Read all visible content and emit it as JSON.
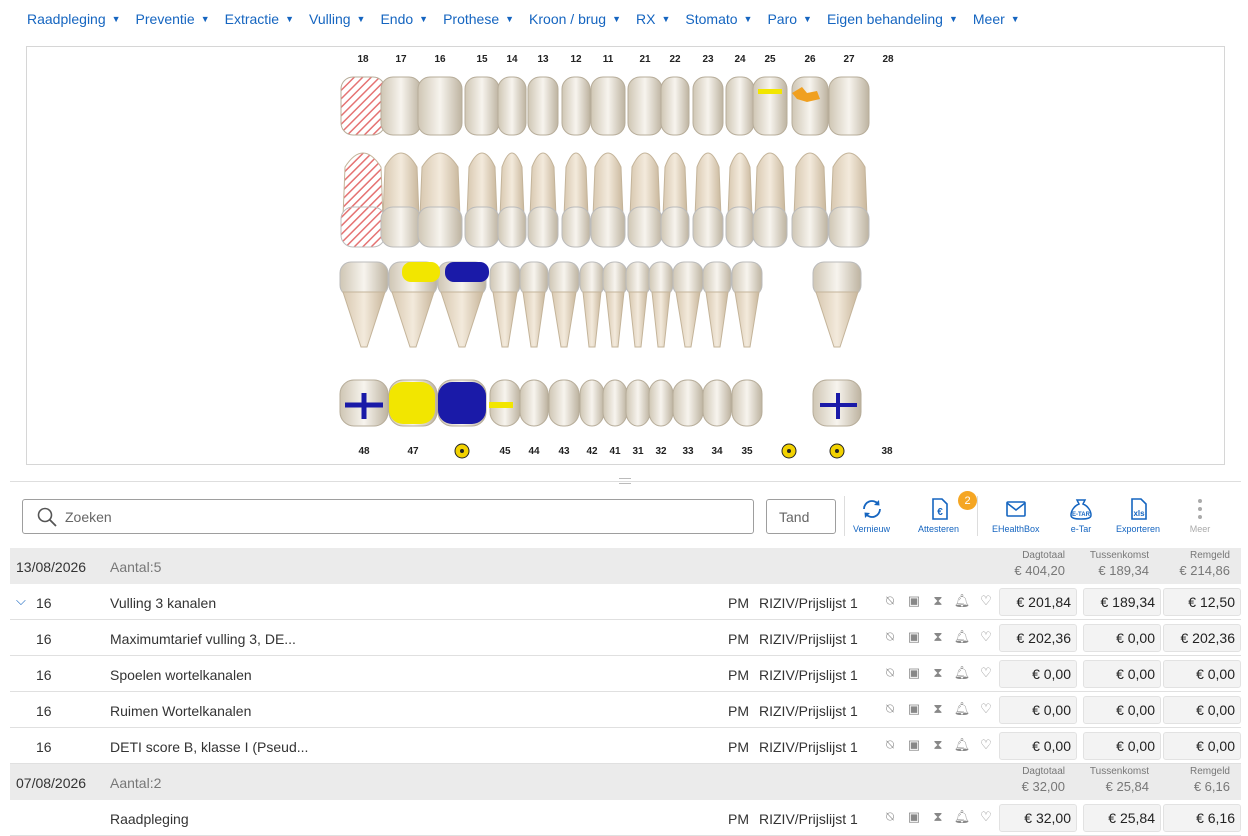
{
  "menu": [
    "Raadpleging",
    "Preventie",
    "Extractie",
    "Vulling",
    "Endo",
    "Prothese",
    "Kroon / brug",
    "RX",
    "Stomato",
    "Paro",
    "Eigen behandeling",
    "Meer"
  ],
  "odontogram": {
    "upper_numbers": [
      "18",
      "17",
      "16",
      "15",
      "14",
      "13",
      "12",
      "11",
      "21",
      "22",
      "23",
      "24",
      "25",
      "26",
      "27",
      "28"
    ],
    "lower_numbers": [
      "48",
      "47",
      "",
      "45",
      "44",
      "43",
      "42",
      "41",
      "31",
      "32",
      "33",
      "34",
      "35",
      "",
      "",
      "38"
    ],
    "radiation_marker_teeth": [
      "46",
      "36",
      "37"
    ],
    "colors": {
      "fill_yellow": "#f2e600",
      "fill_blue": "#1a1aa8",
      "missing_red": "#e57373",
      "orange": "#f0a020"
    }
  },
  "search": {
    "placeholder": "Zoeken"
  },
  "tand": {
    "placeholder": "Tand"
  },
  "toolbar": {
    "vernieuw": "Vernieuw",
    "attesteren": "Attesteren",
    "attesteren_badge": "2",
    "ehealthbox": "EHealthBox",
    "etar": "e-Tar",
    "etar_icon_text": "E-TAR",
    "exporteren": "Exporteren",
    "exporteren_icon_text": "xls",
    "meer": "Meer"
  },
  "groups": [
    {
      "date": "13/08/2026",
      "count": "Aantal:5",
      "totals": {
        "dagtotaal_label": "Dagtotaal",
        "dagtotaal": "€ 404,20",
        "tussenkomst_label": "Tussenkomst",
        "tussenkomst": "€ 189,34",
        "remgeld_label": "Remgeld",
        "remgeld": "€ 214,86"
      },
      "rows": [
        {
          "tooth": "16",
          "desc": "Vulling 3 kanalen",
          "who": "PM",
          "list": "RIZIV/Prijslijst 1",
          "a": "€ 201,84",
          "b": "€ 189,34",
          "c": "€ 12,50"
        },
        {
          "tooth": "16",
          "desc": "Maximumtarief vulling 3, DE...",
          "who": "PM",
          "list": "RIZIV/Prijslijst 1",
          "a": "€ 202,36",
          "b": "€ 0,00",
          "c": "€ 202,36"
        },
        {
          "tooth": "16",
          "desc": "Spoelen wortelkanalen",
          "who": "PM",
          "list": "RIZIV/Prijslijst 1",
          "a": "€ 0,00",
          "b": "€ 0,00",
          "c": "€ 0,00"
        },
        {
          "tooth": "16",
          "desc": "Ruimen Wortelkanalen",
          "who": "PM",
          "list": "RIZIV/Prijslijst 1",
          "a": "€ 0,00",
          "b": "€ 0,00",
          "c": "€ 0,00"
        },
        {
          "tooth": "16",
          "desc": "DETI score B, klasse I (Pseud...",
          "who": "PM",
          "list": "RIZIV/Prijslijst 1",
          "a": "€ 0,00",
          "b": "€ 0,00",
          "c": "€ 0,00"
        }
      ]
    },
    {
      "date": "07/08/2026",
      "count": "Aantal:2",
      "totals": {
        "dagtotaal_label": "Dagtotaal",
        "dagtotaal": "€ 32,00",
        "tussenkomst_label": "Tussenkomst",
        "tussenkomst": "€ 25,84",
        "remgeld_label": "Remgeld",
        "remgeld": "€ 6,16"
      },
      "rows": [
        {
          "tooth": "",
          "desc": "Raadpleging",
          "who": "PM",
          "list": "RIZIV/Prijslijst 1",
          "a": "€ 32,00",
          "b": "€ 25,84",
          "c": "€ 6,16"
        }
      ]
    }
  ]
}
